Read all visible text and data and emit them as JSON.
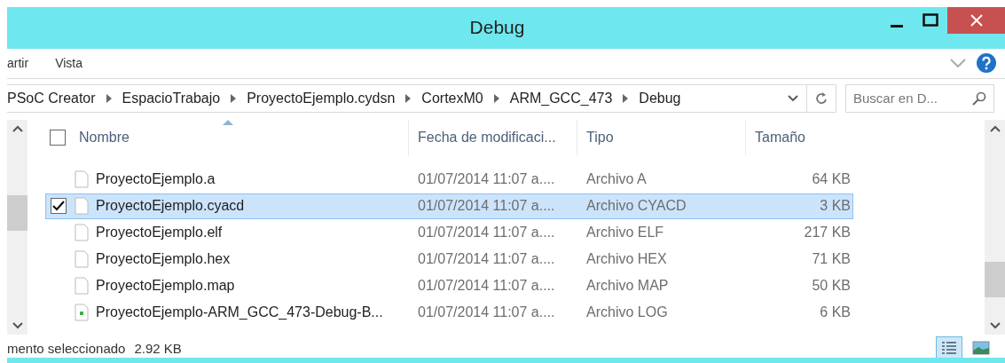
{
  "window": {
    "title": "Debug"
  },
  "ribbon": {
    "tabs": [
      "artir",
      "Vista"
    ]
  },
  "address": {
    "crumbs": [
      "PSoC Creator",
      "EspacioTrabajo",
      "ProyectoEjemplo.cydsn",
      "CortexM0",
      "ARM_GCC_473",
      "Debug"
    ]
  },
  "search": {
    "placeholder": "Buscar en D..."
  },
  "columns": [
    "Nombre",
    "Fecha de modificaci...",
    "Tipo",
    "Tamaño"
  ],
  "header_checkbox": {
    "checked": false
  },
  "rows": [
    {
      "name": "ProyectoEjemplo.a",
      "date": "01/07/2014 11:07 a....",
      "type": "Archivo A",
      "size": "64 KB",
      "selected": false,
      "kind": "file"
    },
    {
      "name": "ProyectoEjemplo.cyacd",
      "date": "01/07/2014 11:07 a....",
      "type": "Archivo CYACD",
      "size": "3 KB",
      "selected": true,
      "kind": "file"
    },
    {
      "name": "ProyectoEjemplo.elf",
      "date": "01/07/2014 11:07 a....",
      "type": "Archivo ELF",
      "size": "217 KB",
      "selected": false,
      "kind": "file"
    },
    {
      "name": "ProyectoEjemplo.hex",
      "date": "01/07/2014 11:07 a....",
      "type": "Archivo HEX",
      "size": "71 KB",
      "selected": false,
      "kind": "file"
    },
    {
      "name": "ProyectoEjemplo.map",
      "date": "01/07/2014 11:07 a....",
      "type": "Archivo MAP",
      "size": "50 KB",
      "selected": false,
      "kind": "file"
    },
    {
      "name": "ProyectoEjemplo-ARM_GCC_473-Debug-B...",
      "date": "01/07/2014 11:07 a....",
      "type": "Archivo LOG",
      "size": "6 KB",
      "selected": false,
      "kind": "log"
    }
  ],
  "status": {
    "text": "mento seleccionado",
    "size": "2.92 KB"
  },
  "view_buttons": [
    {
      "kind": "details",
      "selected": true
    },
    {
      "kind": "thumbnails",
      "selected": false
    }
  ]
}
